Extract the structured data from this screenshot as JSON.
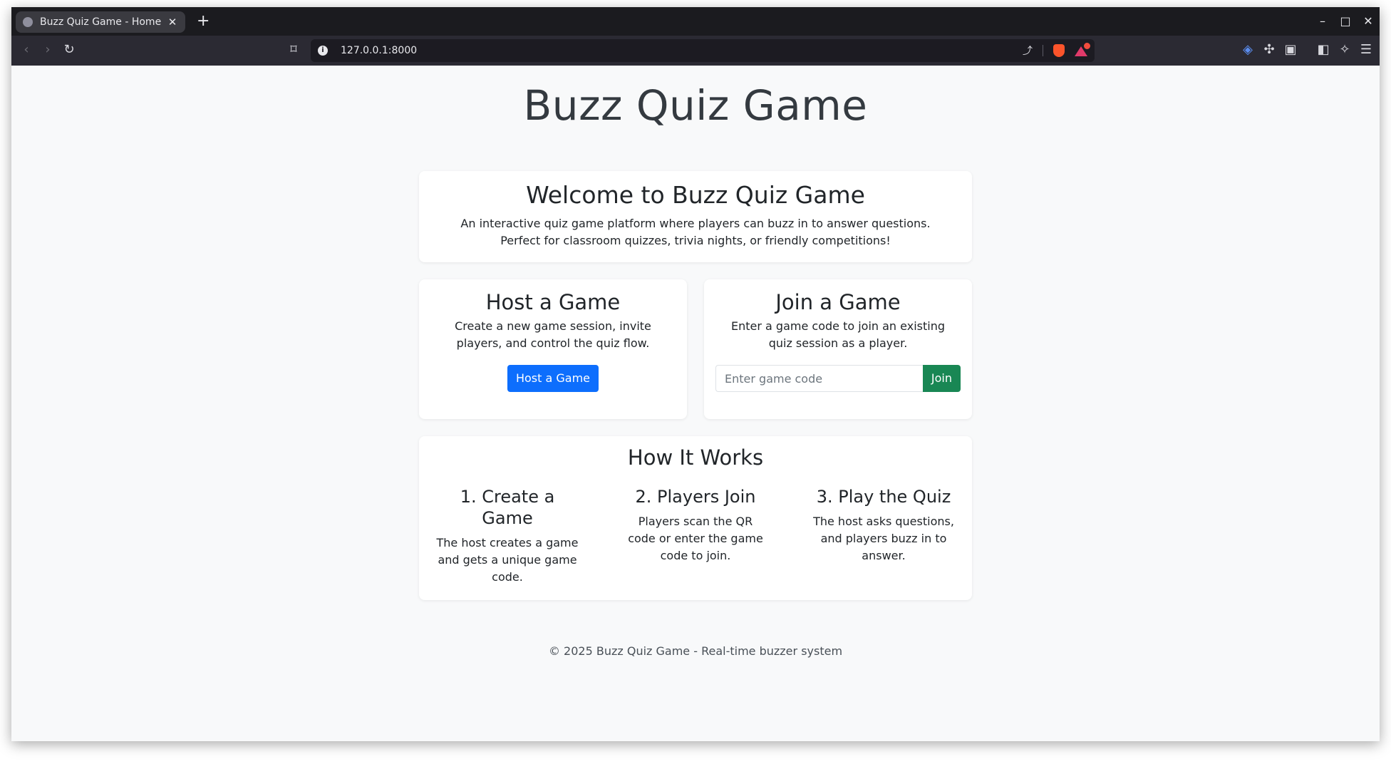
{
  "browser": {
    "tab_title": "Buzz Quiz Game - Home",
    "tab_close": "✕",
    "new_tab": "+",
    "url": "127.0.0.1:8000",
    "window_controls": {
      "minimize": "–",
      "maximize": "□",
      "close": "✕"
    }
  },
  "page": {
    "title": "Buzz Quiz Game",
    "welcome": {
      "heading": "Welcome to Buzz Quiz Game",
      "text": "An interactive quiz game platform where players can buzz in to answer questions. Perfect for classroom quizzes, trivia nights, or friendly competitions!"
    },
    "host": {
      "heading": "Host a Game",
      "text": "Create a new game session, invite players, and control the quiz flow.",
      "button": "Host a Game"
    },
    "join": {
      "heading": "Join a Game",
      "text": "Enter a game code to join an existing quiz session as a player.",
      "input_placeholder": "Enter game code",
      "button": "Join"
    },
    "how": {
      "heading": "How It Works",
      "steps": [
        {
          "title": "1. Create a Game",
          "text": "The host creates a game and gets a unique game code."
        },
        {
          "title": "2. Players Join",
          "text": "Players scan the QR code or enter the game code to join."
        },
        {
          "title": "3. Play the Quiz",
          "text": "The host asks questions, and players buzz in to answer."
        }
      ]
    },
    "footer": "© 2025 Buzz Quiz Game - Real-time buzzer system"
  },
  "colors": {
    "primary": "#0d6efd",
    "success": "#198754",
    "page_bg": "#f8f9fa"
  }
}
